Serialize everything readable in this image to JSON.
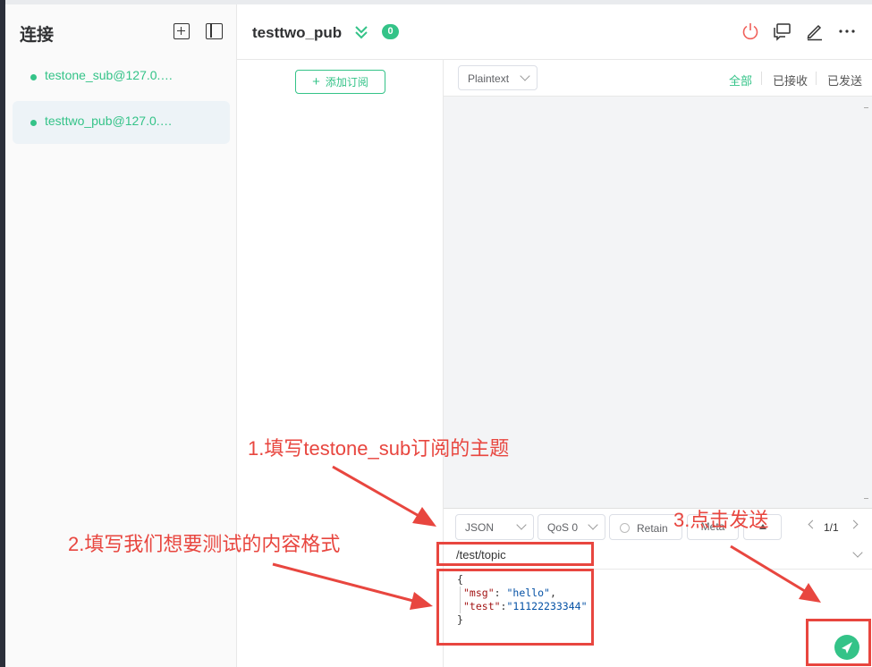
{
  "sidebar": {
    "title": "连接",
    "connections": [
      {
        "label": "testone_sub@127.0.…",
        "status": "connected",
        "active": false
      },
      {
        "label": "testtwo_pub@127.0.…",
        "status": "connected",
        "active": true
      }
    ]
  },
  "header": {
    "title": "testtwo_pub",
    "badge": "0"
  },
  "subscriptions": {
    "add_label": "添加订阅"
  },
  "messages": {
    "format": "Plaintext",
    "filters": [
      "全部",
      "已接收",
      "已发送"
    ],
    "active_filter": "全部"
  },
  "publish": {
    "payload_format": "JSON",
    "qos": "QoS 0",
    "retain_label": "Retain",
    "meta_label": "Meta",
    "pager": "1/1",
    "topic": "/test/topic",
    "payload_lines": [
      "{",
      "  \"msg\": \"hello\",",
      "  \"test\":\"11122233344\"",
      "}"
    ],
    "payload_parts": {
      "open": "{",
      "k1": "\"msg\"",
      "v1": "\"hello\"",
      "k2": "\"test\"",
      "v2": "\"11122233344\"",
      "close": "}"
    }
  },
  "annotations": {
    "step1": "1.填写testone_sub订阅的主题",
    "step2": "2.填写我们想要测试的内容格式",
    "step3": "3.点击发送"
  },
  "colors": {
    "accent": "#34c388",
    "annotation": "#e8463f",
    "sidebar_bg": "#fafafa",
    "message_bg": "#f3f4f6"
  },
  "icons": {
    "new_connection": "plus-square-icon",
    "toggle_panel": "sidebar-panel-icon",
    "collapse": "double-chevron-down-icon",
    "disconnect": "power-icon",
    "new_window": "chat-window-icon",
    "edit": "edit-icon",
    "more": "more-horizontal-icon",
    "send": "send-icon"
  }
}
